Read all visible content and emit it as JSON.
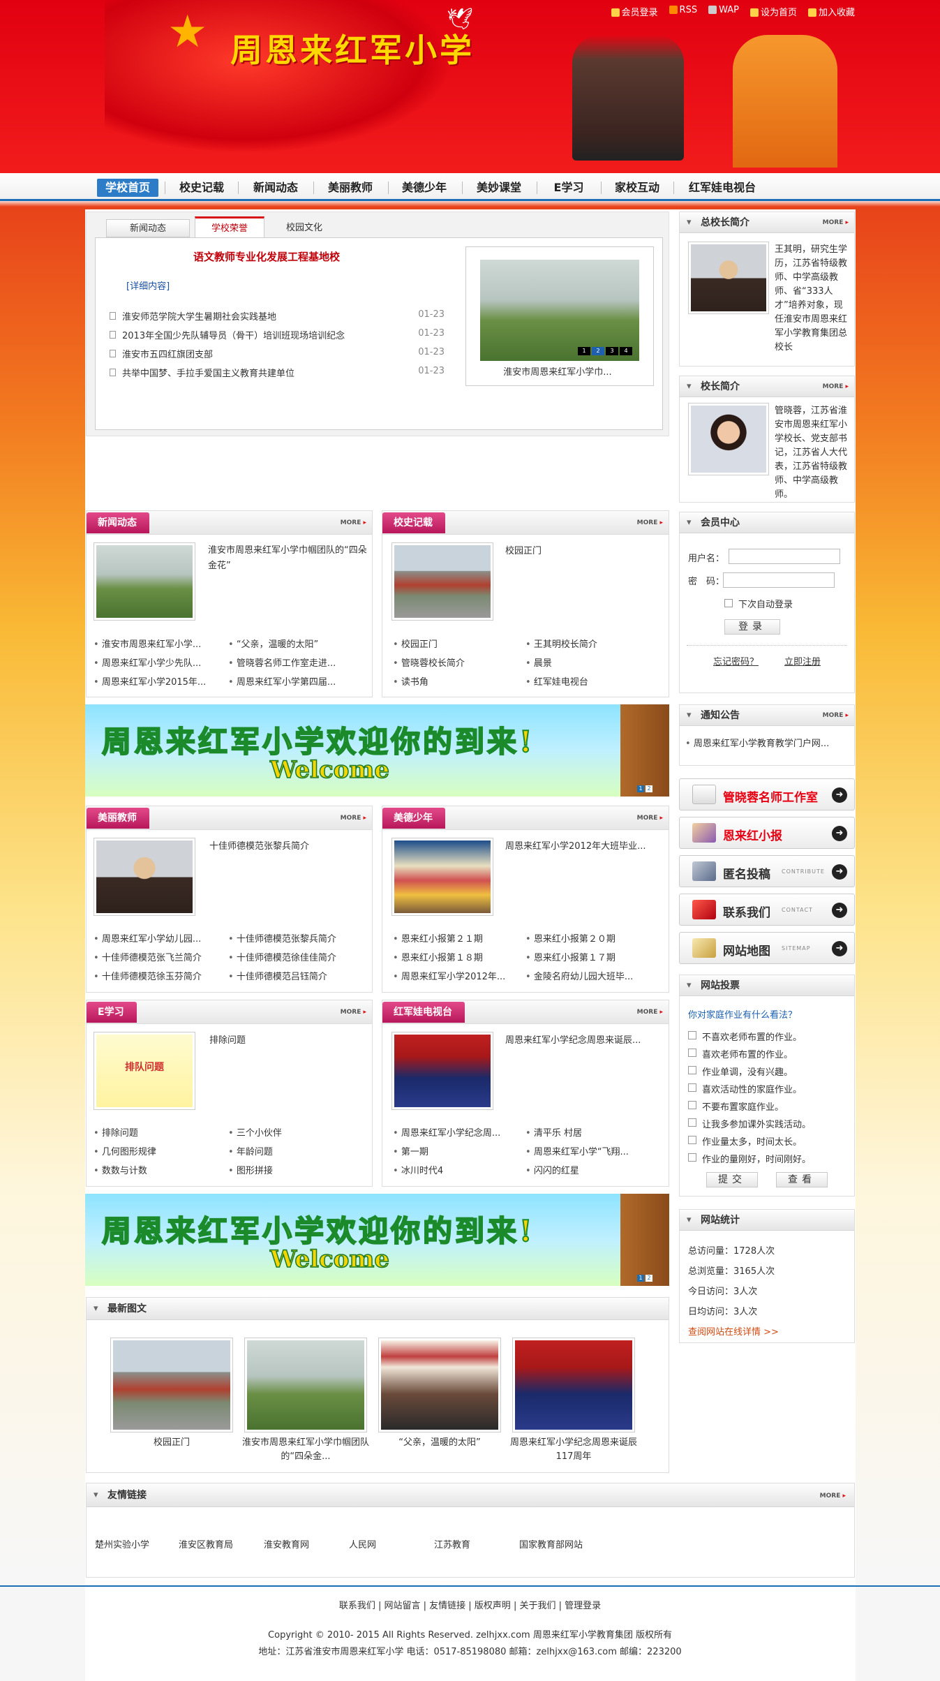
{
  "header": {
    "school_name": "周恩来红军小学",
    "top_links": [
      "会员登录",
      "RSS",
      "WAP",
      "设为首页",
      "加入收藏"
    ]
  },
  "nav": [
    "学校首页",
    "校史记载",
    "新闻动态",
    "美丽教师",
    "美德少年",
    "美妙课堂",
    "E学习",
    "家校互动",
    "红军娃电视台"
  ],
  "feature": {
    "tabs": [
      "新闻动态",
      "学校荣誉",
      "校园文化"
    ],
    "headline": "语文教师专业化发展工程基地校",
    "detail_link": "[详细内容]",
    "items": [
      {
        "title": "淮安师范学院大学生暑期社会实践基地",
        "date": "01-23"
      },
      {
        "title": "2013年全国少先队辅导员（骨干）培训班现场培训纪念",
        "date": "01-23"
      },
      {
        "title": "淮安市五四红旗团支部",
        "date": "01-23"
      },
      {
        "title": "共举中国梦、手拉手爱国主义教育共建单位",
        "date": "01-23"
      }
    ],
    "slide_caption": "淮安市周恩来红军小学巾...",
    "slide_pages": [
      "1",
      "2",
      "3",
      "4"
    ]
  },
  "sections": {
    "news": {
      "title": "新闻动态",
      "more": "MORE",
      "lead": "淮安市周恩来红军小学巾帼团队的“四朵金花”",
      "items": [
        "淮安市周恩来红军小学...",
        "“父亲，温暖的太阳”",
        "周恩来红军小学少先队...",
        "管晓蓉名师工作室走进...",
        "周恩来红军小学2015年...",
        "周恩来红军小学第四届..."
      ]
    },
    "history": {
      "title": "校史记载",
      "more": "MORE",
      "lead": "校园正门",
      "items": [
        "校园正门",
        "王其明校长简介",
        "管晓蓉校长简介",
        "晨景",
        "读书角",
        "红军娃电视台"
      ]
    },
    "teacher": {
      "title": "美丽教师",
      "more": "MORE",
      "lead": "十佳师德模范张黎兵简介",
      "items": [
        "周恩来红军小学幼儿园...",
        "十佳师德模范张黎兵简介",
        "十佳师德模范张飞兰简介",
        "十佳师德模范徐佳佳简介",
        "十佳师德模范徐玉芬简介",
        "十佳师德模范吕钰简介"
      ]
    },
    "youth": {
      "title": "美德少年",
      "more": "MORE",
      "lead": "周恩来红军小学2012年大班毕业...",
      "items": [
        "恩来红小报第２１期",
        "恩来红小报第２０期",
        "恩来红小报第１８期",
        "恩来红小报第１７期",
        "周恩来红军小学2012年...",
        "金陵名府幼儿园大班毕..."
      ]
    },
    "elearn": {
      "title": "E学习",
      "more": "MORE",
      "lead": "排除问题",
      "thumb_text": "排队问题",
      "items": [
        "排除问题",
        "三个小伙伴",
        "几何图形规律",
        "年龄问题",
        "数数与计数",
        "图形拼接"
      ]
    },
    "tv": {
      "title": "红军娃电视台",
      "more": "MORE",
      "lead": "周恩来红军小学纪念周恩来诞辰...",
      "items": [
        "周恩来红军小学纪念周...",
        "清平乐 村居",
        "第一期",
        "周恩来红军小学“飞翔...",
        "冰川时代4",
        "闪闪的红星"
      ]
    }
  },
  "banner": {
    "text": "周恩来红军小学欢迎你的到来!",
    "welcome": "Welcome",
    "pages": [
      "1",
      "2"
    ]
  },
  "latest": {
    "title": "最新图文",
    "items": [
      "校园正门",
      "淮安市周恩来红军小学巾帼团队的“四朵金...",
      "“父亲，温暖的太阳”",
      "周恩来红军小学纪念周恩来诞辰117周年"
    ]
  },
  "links": {
    "title": "友情链接",
    "more": "MORE",
    "items": [
      "楚州实验小学",
      "淮安区教育局",
      "淮安教育网",
      "人民网",
      "江苏教育",
      "国家教育部网站"
    ]
  },
  "sidebar": {
    "principal_main": {
      "title": "总校长简介",
      "more": "MORE",
      "text": "王其明，研究生学历，江苏省特级教师、中学高级教师、省“333人才”培养对象，现任淮安市周恩来红军小学教育集团总校长"
    },
    "principal": {
      "title": "校长简介",
      "more": "MORE",
      "text": "管晓蓉，江苏省淮安市周恩来红军小学校长、党支部书记，江苏省人大代表，江苏省特级教师、中学高级教师。"
    },
    "member": {
      "title": "会员中心",
      "username_label": "用户名：",
      "password_label": "密　码：",
      "remember": "下次自动登录",
      "login": "登录",
      "forgot": "忘记密码？",
      "register": "立即注册"
    },
    "notice": {
      "title": "通知公告",
      "more": "MORE",
      "items": [
        "周恩来红军小学教育教学门户网..."
      ]
    },
    "quick": [
      {
        "label": "管晓蓉名师工作室",
        "en": "",
        "color": "#e60012"
      },
      {
        "label": "恩来红小报",
        "en": "",
        "color": "#e60012"
      },
      {
        "label": "匿名投稿",
        "en": "CONTRIBUTE",
        "color": "#222222"
      },
      {
        "label": "联系我们",
        "en": "CONTACT",
        "color": "#222222"
      },
      {
        "label": "网站地图",
        "en": "SITEMAP",
        "color": "#222222"
      }
    ],
    "vote": {
      "title": "网站投票",
      "question": "你对家庭作业有什么看法？",
      "options": [
        "不喜欢老师布置的作业。",
        "喜欢老师布置的作业。",
        "作业单调，没有兴趣。",
        "喜欢活动性的家庭作业。",
        "不要布置家庭作业。",
        "让我多参加课外实践活动。",
        "作业量太多，时间太长。",
        "作业的量刚好，时间刚好。"
      ],
      "submit": "提交",
      "view": "查看"
    },
    "stats": {
      "title": "网站统计",
      "lines": [
        "总访问量：1728人次",
        "总浏览量：3165人次",
        "今日访问：3人次",
        "日均访问：3人次"
      ],
      "detail": "查阅网站在线详情 >>"
    }
  },
  "footer": {
    "links": "联系我们 | 网站留言 | 友情链接 | 版权声明 | 关于我们 | 管理登录",
    "copyright": "Copyright © 2010- 2015 All Rights Reserved. zelhjxx.com 周恩来红军小学教育集团 版权所有",
    "address": "地址：江苏省淮安市周恩来红军小学 电话：0517-85198080 邮箱：zelhjxx@163.com 邮编：223200"
  }
}
